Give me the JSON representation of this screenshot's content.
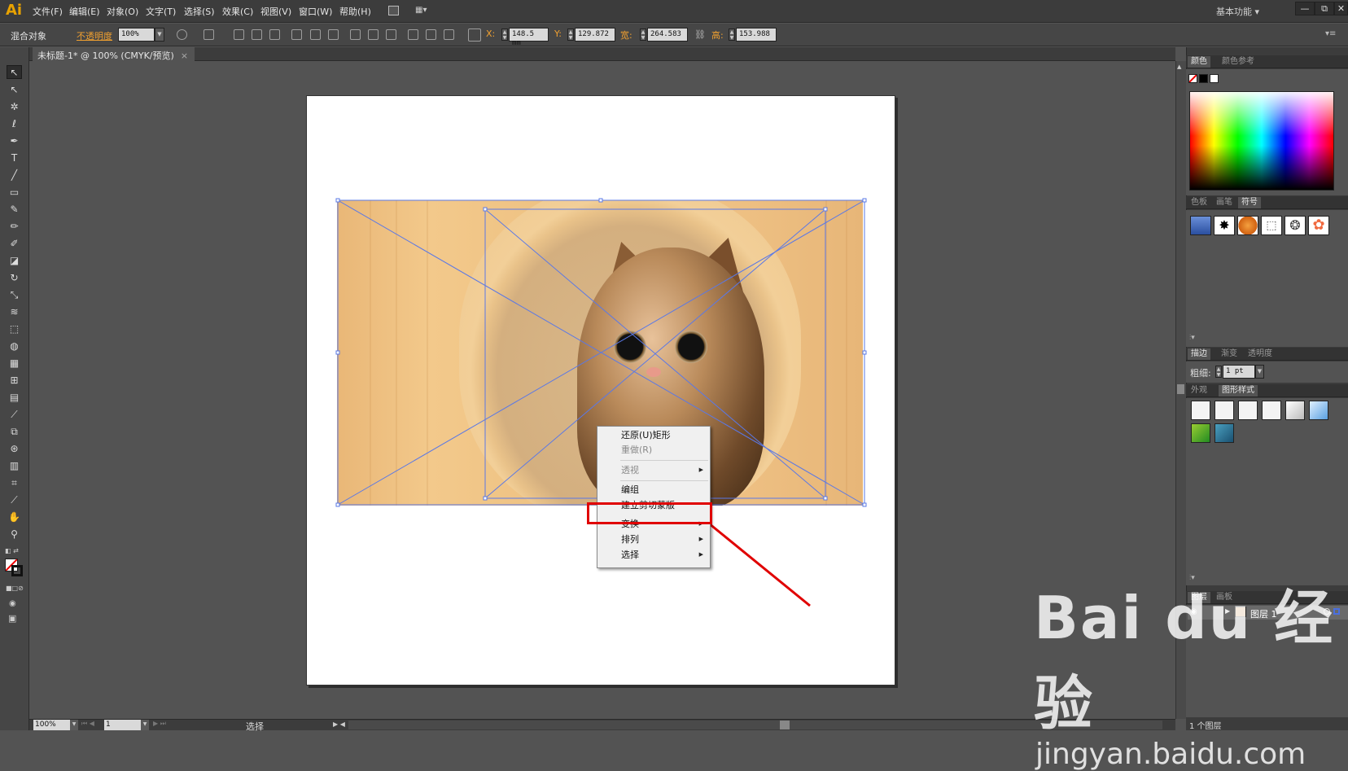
{
  "app": {
    "logo": "Ai",
    "workspace": "基本功能 ▾",
    "win_buttons": [
      "—",
      "⧉",
      "✕"
    ]
  },
  "menubar": {
    "items": [
      "文件(F)",
      "编辑(E)",
      "对象(O)",
      "文字(T)",
      "选择(S)",
      "效果(C)",
      "视图(V)",
      "窗口(W)",
      "帮助(H)"
    ]
  },
  "controlbar": {
    "object_type": "混合对象",
    "opacity_label": "不透明度",
    "opacity_value": "100%",
    "x_label": "X:",
    "x_value": "148.5 mm",
    "y_label": "Y:",
    "y_value": "129.872 ",
    "w_label": "宽:",
    "w_value": "264.583 ",
    "h_label": "高:",
    "h_value": "153.988 "
  },
  "document": {
    "tab_title": "未标题-1* @ 100% (CMYK/预览)",
    "tab_close": "×"
  },
  "context_menu": {
    "items": [
      {
        "label": "还原(U)矩形",
        "enabled": true,
        "submenu": false
      },
      {
        "label": "重做(R)",
        "enabled": false,
        "submenu": false
      },
      {
        "label": "透视",
        "enabled": false,
        "submenu": true
      },
      {
        "label": "编组",
        "enabled": true,
        "submenu": false
      },
      {
        "label": "建立剪切蒙版",
        "enabled": true,
        "submenu": false
      },
      {
        "label": "变换",
        "enabled": true,
        "submenu": true
      },
      {
        "label": "排列",
        "enabled": true,
        "submenu": true
      },
      {
        "label": "选择",
        "enabled": true,
        "submenu": true
      }
    ],
    "highlight_color": "#e00000"
  },
  "panels": {
    "color_tabs": [
      "颜色",
      "颜色参考"
    ],
    "swatch_tabs": [
      "色板",
      "画笔",
      "符号"
    ],
    "stroke_tabs": [
      "描边",
      "渐变",
      "透明度"
    ],
    "stroke_weight_label": "粗细:",
    "stroke_weight_value": "1 pt",
    "appearance_tabs": [
      "外观",
      "图形样式"
    ],
    "layers_tabs": [
      "图层",
      "画板"
    ],
    "layer_name": "图层 1",
    "layer_count": "1 个图层"
  },
  "statusbar": {
    "zoom": "100%",
    "page": "1",
    "tool": "选择"
  },
  "watermark": {
    "big": "Bai du 经验",
    "small": "jingyan.baidu.com"
  }
}
